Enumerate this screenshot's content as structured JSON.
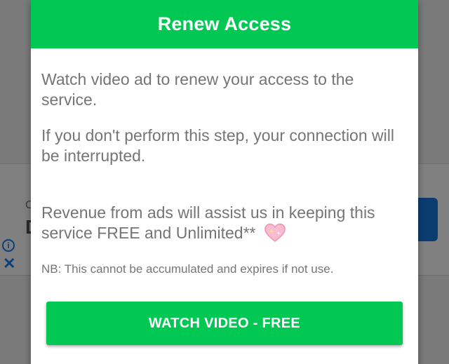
{
  "dialog": {
    "title": "Renew Access",
    "paragraph_1": "Watch video ad to renew your access to the service.",
    "paragraph_2": "If you don't perform this step, your connection will be interrupted.",
    "paragraph_3": "Revenue from ads will assist us in keeping this service FREE and Unlimited**",
    "note": "NB: This cannot be accumulated and expires if not use.",
    "button_label": "WATCH VIDEO - FREE",
    "icon": "sparkling-heart-icon"
  },
  "background_ad": {
    "letter_small": "C",
    "letter_big": "D",
    "info_icon": "info-icon",
    "close_icon": "close-icon"
  },
  "colors": {
    "accent_green": "#00c853",
    "overlay_gray": "#7a7a7a",
    "text_gray": "#757575",
    "ad_blue": "#0b3c6f"
  }
}
